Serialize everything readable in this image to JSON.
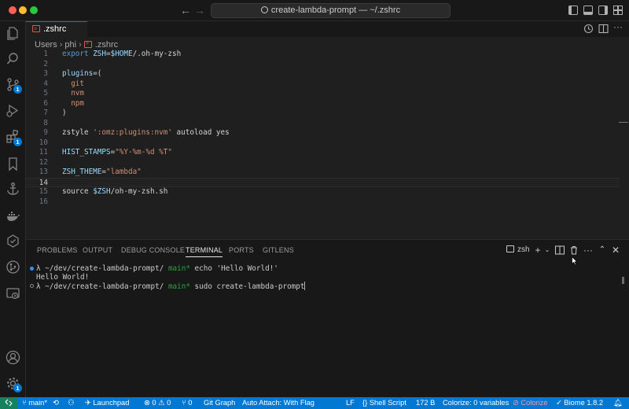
{
  "window": {
    "title": "create-lambda-prompt — ~/.zshrc"
  },
  "activity_bar": {
    "items": [
      {
        "icon": "files-icon"
      },
      {
        "icon": "search-icon"
      },
      {
        "icon": "source-control-icon",
        "badge": "1"
      },
      {
        "icon": "run-debug-icon"
      },
      {
        "icon": "extensions-icon",
        "badge": "1"
      },
      {
        "icon": "bookmark-icon"
      },
      {
        "icon": "anchor-icon"
      },
      {
        "icon": "docker-icon"
      },
      {
        "icon": "testing-icon"
      },
      {
        "icon": "gitlens-icon"
      },
      {
        "icon": "remote-explorer-icon"
      }
    ],
    "bottom": {
      "account_icon": "account-icon",
      "manage_icon": "gear-icon",
      "manage_badge": "1"
    }
  },
  "editor": {
    "tab": {
      "label": ".zshrc"
    },
    "breadcrumb": [
      "Users",
      "phi",
      ".zshrc"
    ],
    "lines": [
      {
        "n": "1",
        "text": "export ZSH=$HOME/.oh-my-zsh"
      },
      {
        "n": "2",
        "text": ""
      },
      {
        "n": "3",
        "text": "plugins=("
      },
      {
        "n": "4",
        "text": "  git"
      },
      {
        "n": "5",
        "text": "  nvm"
      },
      {
        "n": "6",
        "text": "  npm"
      },
      {
        "n": "7",
        "text": ")"
      },
      {
        "n": "8",
        "text": ""
      },
      {
        "n": "9",
        "text": "zstyle ':omz:plugins:nvm' autoload yes"
      },
      {
        "n": "10",
        "text": ""
      },
      {
        "n": "11",
        "text": "HIST_STAMPS=\"%Y-%m-%d %T\""
      },
      {
        "n": "12",
        "text": ""
      },
      {
        "n": "13",
        "text": "ZSH_THEME=\"lambda\""
      },
      {
        "n": "14",
        "text": ""
      },
      {
        "n": "15",
        "text": "source $ZSH/oh-my-zsh.sh"
      },
      {
        "n": "16",
        "text": ""
      }
    ],
    "current_line": "14"
  },
  "panel": {
    "tabs": [
      "PROBLEMS",
      "OUTPUT",
      "DEBUG CONSOLE",
      "TERMINAL",
      "PORTS",
      "GITLENS"
    ],
    "active_tab": "TERMINAL",
    "terminal_name": "zsh",
    "terminal": {
      "line1": {
        "prompt": "λ ~/dev/create-lambda-prompt/",
        "branch": "main*",
        "command": "echo 'Hello World!'"
      },
      "line2": {
        "output": "Hello World!"
      },
      "line3": {
        "prompt": "λ ~/dev/create-lambda-prompt/",
        "branch": "main*",
        "command": "sudo create-lambda-prompt"
      }
    }
  },
  "status_bar": {
    "branch": "main*",
    "launchpad": "Launchpad",
    "errors": "0",
    "warnings": "0",
    "ports": "0",
    "git_graph": "Git Graph",
    "auto_attach": "Auto Attach: With Flag",
    "eol": "LF",
    "language": "Shell Script",
    "size": "172 B",
    "colorize": "Colorize: 0 variables",
    "colorize_toggle": "Colorize",
    "biome": "Biome 1.8.2"
  },
  "colors": {
    "accent": "#0078d4",
    "remote": "#16825d",
    "editor_bg": "#1f1f1f",
    "chrome_bg": "#181818",
    "keyword": "#569cd6",
    "string": "#ce9178",
    "branch": "#2ea043"
  }
}
